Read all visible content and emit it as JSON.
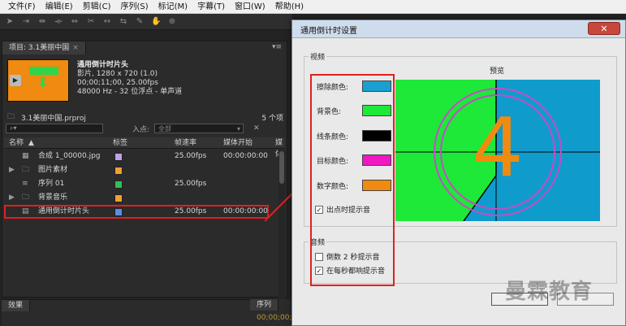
{
  "menubar": {
    "items": [
      "文件(F)",
      "编辑(E)",
      "剪辑(C)",
      "序列(S)",
      "标记(M)",
      "字幕(T)",
      "窗口(W)",
      "帮助(H)"
    ]
  },
  "project_panel": {
    "tab_label": "项目: 3.1美丽中国",
    "tab_close": "×",
    "menu_icon": "panel-menu-icon",
    "asset": {
      "name": "通用倒计时片头",
      "line1": "影片, 1280 x 720 (1.0)",
      "line2": "00;00;11;00, 25.00fps",
      "line3": "48000 Hz - 32 位浮点 - 单声道"
    },
    "project_file": "3.1美丽中国.prproj",
    "item_count": "5 个项",
    "search_icon": "search-icon",
    "entry_label": "入点:",
    "entry_value": "全部",
    "columns": [
      "名称",
      "标签",
      "帧速率",
      "媒体开始",
      "媒体"
    ],
    "rows": [
      {
        "expand": "",
        "icon": "image-icon",
        "name": "合成 1_00000.jpg",
        "label_color": "#b9a4e8",
        "fps": "25.00fps",
        "start": "00:00:00:00"
      },
      {
        "expand": "▶",
        "icon": "folder-icon",
        "name": "图片素材",
        "label_color": "#f0a030",
        "fps": "",
        "start": ""
      },
      {
        "expand": "",
        "icon": "sequence-icon",
        "name": "序列 01",
        "label_color": "#2fc05a",
        "fps": "25.00fps",
        "start": ""
      },
      {
        "expand": "▶",
        "icon": "folder-icon",
        "name": "背景音乐",
        "label_color": "#f0a030",
        "fps": "",
        "start": ""
      },
      {
        "expand": "",
        "icon": "countdown-icon",
        "name": "通用倒计时片头",
        "label_color": "#5a8ee8",
        "fps": "25.00fps",
        "start": "00:00:00:00"
      }
    ]
  },
  "bottom": {
    "effects_tab": "效果",
    "sequence_tab": "序列",
    "timecode": "00;00;00;00"
  },
  "dialog": {
    "title": "通用倒计时设置",
    "close_label": "✕",
    "video_group": "视频",
    "preview_label": "预览",
    "colors": [
      {
        "label": "擦除颜色:",
        "value": "#1aa0d0"
      },
      {
        "label": "背景色:",
        "value": "#1ee838"
      },
      {
        "label": "线条颜色:",
        "value": "#000000"
      },
      {
        "label": "目标颜色:",
        "value": "#f018c0"
      },
      {
        "label": "数字颜色:",
        "value": "#f08a10"
      }
    ],
    "cue_on_out": {
      "label": "出点时提示音",
      "checked": true
    },
    "audio_group": "音频",
    "cue_2sec": {
      "label": "倒数 2 秒提示音",
      "checked": false
    },
    "cue_every_sec": {
      "label": "在每秒都响提示音",
      "checked": true
    },
    "preview": {
      "digit": "4",
      "wipe_color": "#1aa0d0",
      "background_color": "#1ee838",
      "line_color": "#000000",
      "target_color": "#f018c0",
      "digit_color": "#f08a10"
    }
  },
  "watermark": "曼霖教育"
}
